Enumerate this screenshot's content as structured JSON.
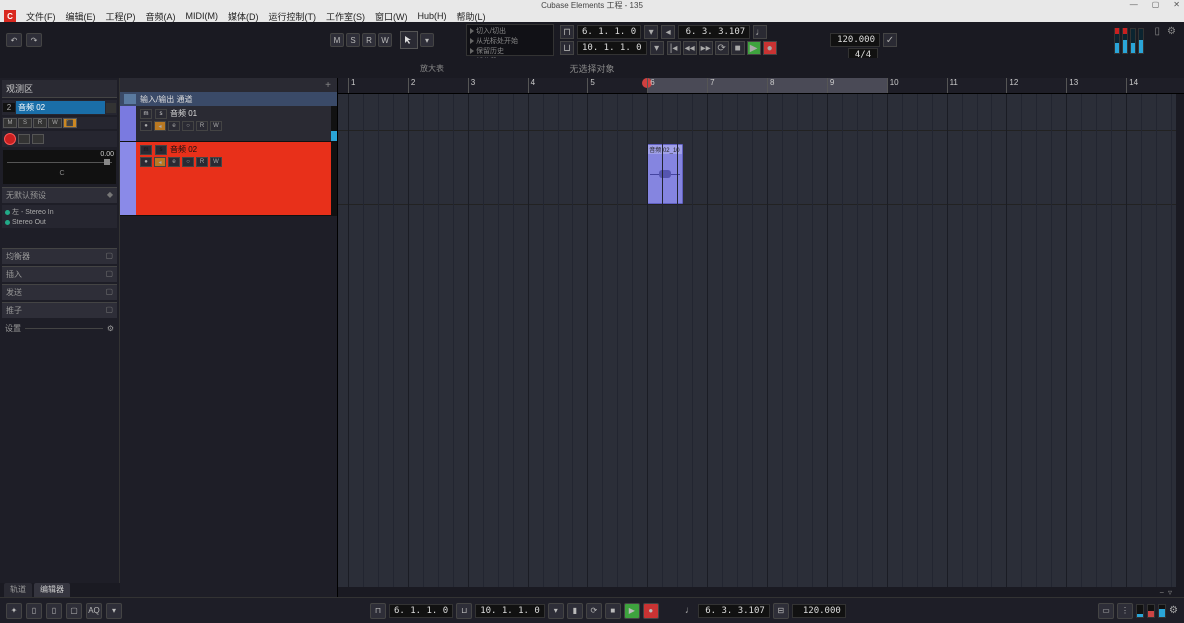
{
  "window": {
    "title": "Cubase Elements 工程 - 135"
  },
  "menu": [
    "文件(F)",
    "编辑(E)",
    "工程(P)",
    "音频(A)",
    "MIDI(M)",
    "媒体(D)",
    "运行控制(T)",
    "工作室(S)",
    "窗口(W)",
    "Hub(H)",
    "帮助(L)"
  ],
  "snap_buttons": [
    "M",
    "S",
    "R",
    "W"
  ],
  "history_panel": {
    "items": [
      "切入/切出",
      "从光标处开始",
      "保留历史",
      "新分段"
    ]
  },
  "transport": {
    "primary_left": "6. 1. 1.   0",
    "primary_right": "6.   3.   3.107",
    "secondary_left": "10. 1. 1.   0",
    "tempo": "120.000",
    "signature": "4/4"
  },
  "sub_strip": {
    "left_txt": "放大表",
    "center_txt": "无选择对象"
  },
  "inspector": {
    "tab": "观测区",
    "track_num": "2",
    "track_name": "音频 02",
    "btns": [
      "M",
      "S",
      "R",
      "W",
      "⬛"
    ],
    "vol": "0.00",
    "pan": "C",
    "routing_header": "无默认预设",
    "routing": [
      "左 - Stereo In",
      "Stereo Out"
    ],
    "sections": [
      "均衡器",
      "插入",
      "发送",
      "推子"
    ],
    "settings": "设置"
  },
  "track_list": {
    "io_header": "输入/输出 通道",
    "tracks": [
      {
        "name": "音频 01"
      },
      {
        "name": "音频 02"
      }
    ]
  },
  "ruler": {
    "start": 1,
    "end": 14,
    "locator_l": 6,
    "locator_r": 10,
    "cursor": 6
  },
  "clip": {
    "name": "音频 02_10",
    "bar_start": 6,
    "bar_end": 6.6,
    "track": 2
  },
  "bottom_tabs": [
    "轨道",
    "编辑器"
  ],
  "bottom_bar": {
    "pos1": "6. 1. 1.   0",
    "pos2": "10. 1. 1.   0",
    "cursor": "6.   3.   3.107",
    "tempo": "120.000",
    "aq": "AQ"
  }
}
